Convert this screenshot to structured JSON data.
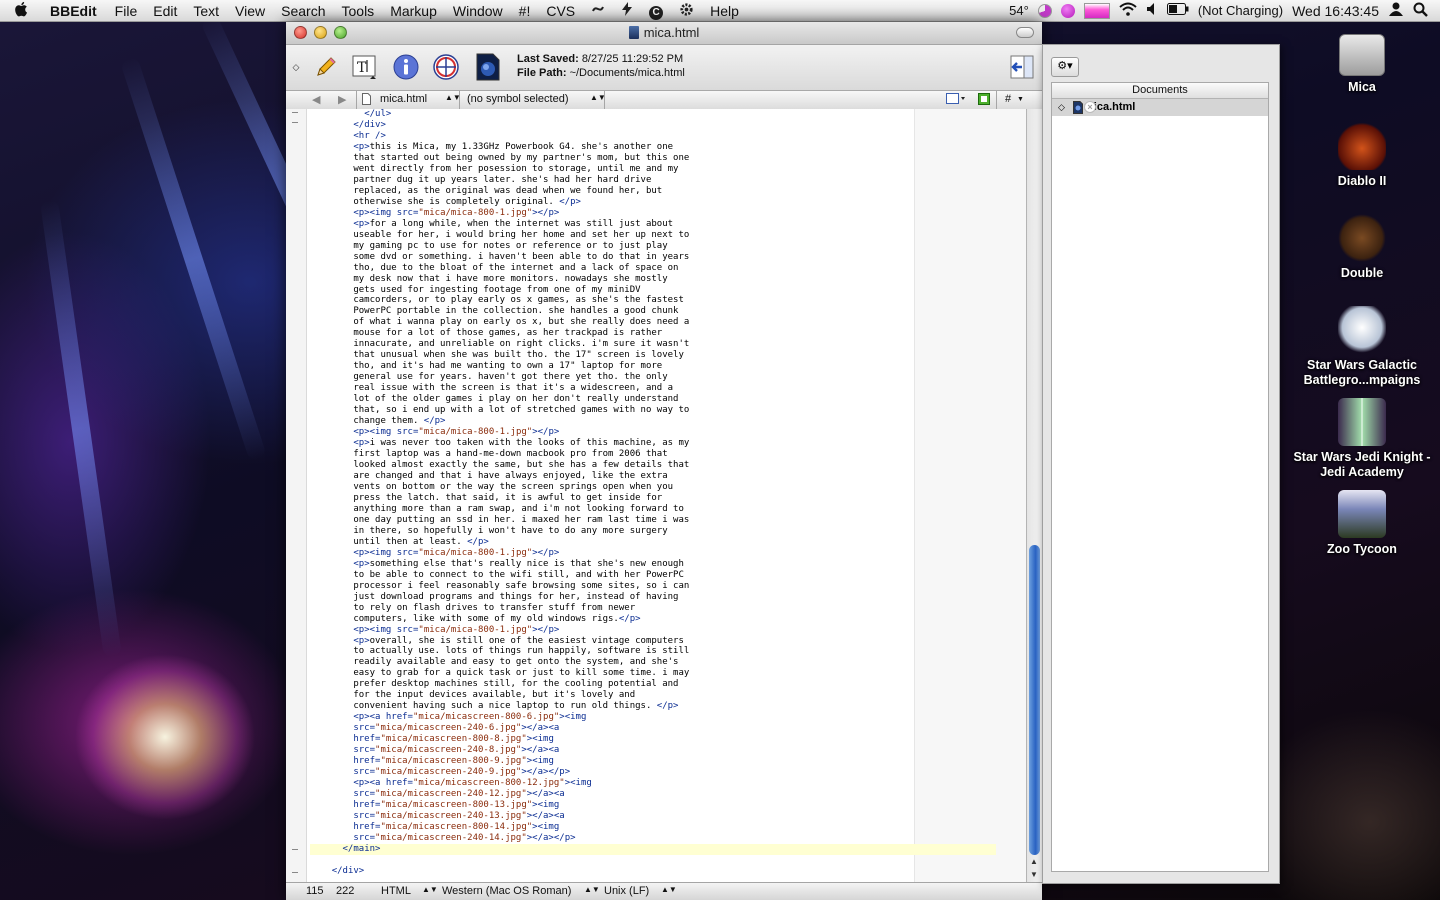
{
  "menubar": {
    "apple": "",
    "app_name": "BBEdit",
    "items": [
      "File",
      "Edit",
      "Text",
      "View",
      "Search",
      "Tools",
      "Markup",
      "Window",
      "#!",
      "CVS"
    ],
    "help": "Help",
    "status": {
      "temperature": "54°",
      "battery": "(Not Charging)",
      "clock": "Wed 16:43:45"
    }
  },
  "window": {
    "title": "mica.html",
    "toolbar": {
      "last_saved_label": "Last Saved:",
      "last_saved_value": "8/27/25 11:29:52 PM",
      "file_path_label": "File Path:",
      "file_path_value": "~/Documents/mica.html"
    },
    "navbar": {
      "file_popup": "mica.html",
      "symbol_popup": "(no symbol selected)",
      "hash": "#"
    },
    "status": {
      "line": "115",
      "column": "222",
      "language": "HTML",
      "encoding": "Western (Mac OS Roman)",
      "line_endings": "Unix (LF)"
    }
  },
  "code_lines": [
    "          </ul>",
    "        </div>",
    "        <hr />",
    "        <p>this is Mica, my 1.33GHz Powerbook G4. she's another one",
    "        that started out being owned by my partner's mom, but this one",
    "        went directly from her posession to storage, until me and my",
    "        partner dug it up years later. she's had her hard drive",
    "        replaced, as the original was dead when we found her, but",
    "        otherwise she is completely original. </p>",
    "        <p><img src=\"mica/mica-800-1.jpg\"></p>",
    "        <p>for a long while, when the internet was still just about",
    "        useable for her, i would bring her home and set her up next to",
    "        my gaming pc to use for notes or reference or to just play",
    "        some dvd or something. i haven't been able to do that in years",
    "        tho, due to the bloat of the internet and a lack of space on",
    "        my desk now that i have more monitors. nowadays she mostly",
    "        gets used for ingesting footage from one of my miniDV",
    "        camcorders, or to play early os x games, as she's the fastest",
    "        PowerPC portable in the collection. she handles a good chunk",
    "        of what i wanna play on early os x, but she really does need a",
    "        mouse for a lot of those games, as her trackpad is rather",
    "        innacurate, and unreliable on right clicks. i'm sure it wasn't",
    "        that unusual when she was built tho. the 17\" screen is lovely",
    "        tho, and it's had me wanting to own a 17\" laptop for more",
    "        general use for years. haven't got there yet tho. the only",
    "        real issue with the screen is that it's a widescreen, and a",
    "        lot of the older games i play on her don't really understand",
    "        that, so i end up with a lot of stretched games with no way to",
    "        change them. </p>",
    "        <p><img src=\"mica/mica-800-1.jpg\"></p>",
    "        <p>i was never too taken with the looks of this machine, as my",
    "        first laptop was a hand-me-down macbook pro from 2006 that",
    "        looked almost exactly the same, but she has a few details that",
    "        are changed and that i have always enjoyed, like the extra",
    "        vents on bottom or the way the screen springs open when you",
    "        press the latch. that said, it is awful to get inside for",
    "        anything more than a ram swap, and i'm not looking forward to",
    "        one day putting an ssd in her. i maxed her ram last time i was",
    "        in there, so hopefully i won't have to do any more surgery",
    "        until then at least. </p>",
    "        <p><img src=\"mica/mica-800-1.jpg\"></p>",
    "        <p>something else that's really nice is that she's new enough",
    "        to be able to connect to the wifi still, and with her PowerPC",
    "        processor i feel reasonably safe browsing some sites, so i can",
    "        just download programs and things for her, instead of having",
    "        to rely on flash drives to transfer stuff from newer",
    "        computers, like with some of my old windows rigs.</p>",
    "        <p><img src=\"mica/mica-800-1.jpg\"></p>",
    "        <p>overall, she is still one of the easiest vintage computers",
    "        to actually use. lots of things run happily, software is still",
    "        readily available and easy to get onto the system, and she's",
    "        easy to grab for a quick task or just to kill some time. i may",
    "        prefer desktop machines still, for the cooling potential and",
    "        for the input devices available, but it's lovely and",
    "        convenient having such a nice laptop to run old things. </p>",
    "        <p><a href=\"mica/micascreen-800-6.jpg\"><img",
    "        src=\"mica/micascreen-240-6.jpg\"></a><a",
    "        href=\"mica/micascreen-800-8.jpg\"><img",
    "        src=\"mica/micascreen-240-8.jpg\"></a><a",
    "        href=\"mica/micascreen-800-9.jpg\"><img",
    "        src=\"mica/micascreen-240-9.jpg\"></a></p>",
    "        <p><a href=\"mica/micascreen-800-12.jpg\"><img",
    "        src=\"mica/micascreen-240-12.jpg\"></a><a",
    "        href=\"mica/micascreen-800-13.jpg\"><img",
    "        src=\"mica/micascreen-240-13.jpg\"></a><a",
    "        href=\"mica/micascreen-800-14.jpg\"><img",
    "        src=\"mica/micascreen-240-14.jpg\"></a></p>",
    "      </main>",
    "",
    "    </div>"
  ],
  "highlight_line": 67,
  "drawer": {
    "header": "Documents",
    "documents": [
      "mica.html"
    ]
  },
  "desktop_icons": [
    {
      "label": "Mica"
    },
    {
      "label": "Diablo II"
    },
    {
      "label": "Double"
    },
    {
      "label": "Star Wars Galactic Battlegro...mpaigns"
    },
    {
      "label": "Star Wars Jedi Knight - Jedi Academy"
    },
    {
      "label": "Zoo Tycoon"
    }
  ],
  "colors": {
    "tag": "#0b2d92",
    "string": "#8a2c0c",
    "selection_highlight": "#ffffd2",
    "scroll_thumb": "#2a63c4"
  }
}
